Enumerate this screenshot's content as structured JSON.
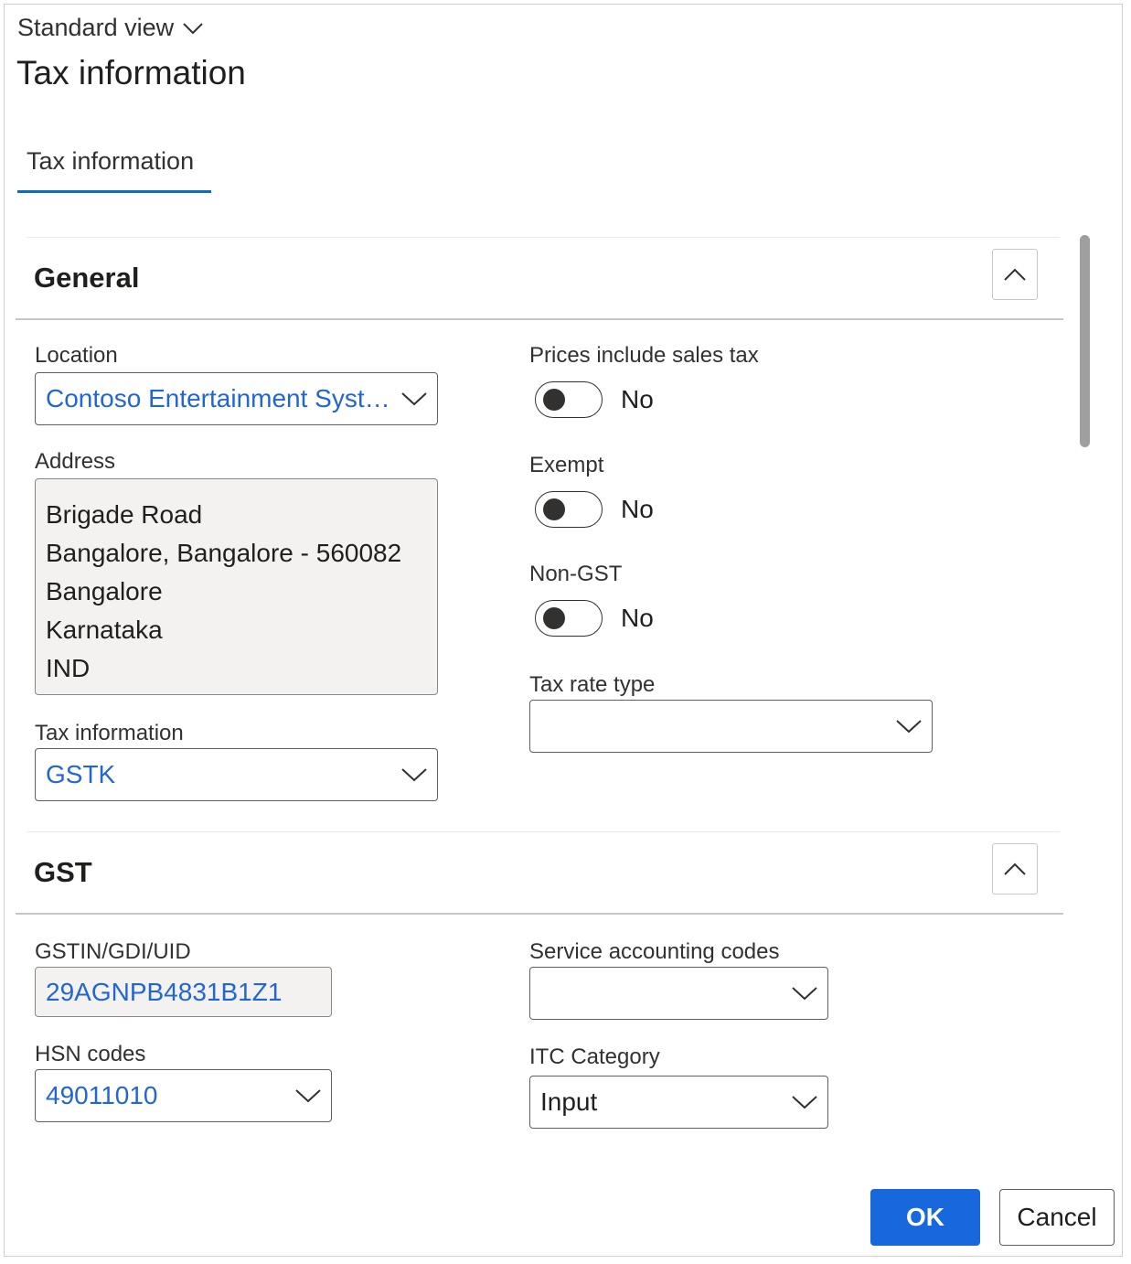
{
  "header": {
    "view_label": "Standard view",
    "title": "Tax information"
  },
  "tabs": [
    {
      "label": "Tax information",
      "selected": true
    }
  ],
  "general": {
    "title": "General",
    "location": {
      "label": "Location",
      "value": "Contoso Entertainment Syste..."
    },
    "address": {
      "label": "Address",
      "lines": [
        "Brigade Road",
        "Bangalore, Bangalore - 560082",
        "Bangalore",
        "Karnataka",
        "IND"
      ]
    },
    "tax_information": {
      "label": "Tax information",
      "value": "GSTK"
    },
    "prices_include_sales_tax": {
      "label": "Prices include sales tax",
      "value": "No"
    },
    "exempt": {
      "label": "Exempt",
      "value": "No"
    },
    "non_gst": {
      "label": "Non-GST",
      "value": "No"
    },
    "tax_rate_type": {
      "label": "Tax rate type",
      "value": ""
    }
  },
  "gst": {
    "title": "GST",
    "gstin": {
      "label": "GSTIN/GDI/UID",
      "value": "29AGNPB4831B1Z1"
    },
    "hsn_codes": {
      "label": "HSN codes",
      "value": "49011010"
    },
    "service_accounting_codes": {
      "label": "Service accounting codes",
      "value": ""
    },
    "itc_category": {
      "label": "ITC Category",
      "value": "Input"
    }
  },
  "footer": {
    "ok_label": "OK",
    "cancel_label": "Cancel"
  },
  "colors": {
    "accent": "#0f6cbd",
    "primary_button": "#1668dc",
    "link_text": "#2266d4",
    "readonly_bg": "#f3f2f1"
  }
}
